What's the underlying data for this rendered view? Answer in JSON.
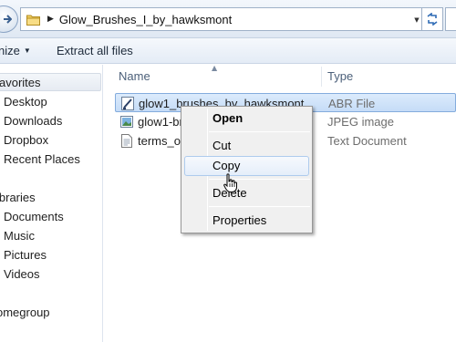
{
  "address_bar": {
    "path": "Glow_Brushes_I_by_hawksmont",
    "separator": "▶",
    "dropdown": "▼"
  },
  "toolbar": {
    "organize_label": "nize",
    "organize_arrow": "▼",
    "extract_label": "Extract all files"
  },
  "nav": {
    "favorites_label": "avorites",
    "favorites": [
      "Desktop",
      "Downloads",
      "Dropbox",
      "Recent Places"
    ],
    "libraries_label": "ibraries",
    "libraries": [
      "Documents",
      "Music",
      "Pictures",
      "Videos"
    ],
    "homegroup_label": "omegroup"
  },
  "file_list": {
    "columns": {
      "name": "Name",
      "type": "Type"
    },
    "sort_caret": "▲",
    "files": [
      {
        "name": "glow1_brushes_by_hawksmont",
        "type": "ABR File",
        "icon": "abr-file-icon",
        "selected": true
      },
      {
        "name": "glow1-br",
        "type": "JPEG image",
        "icon": "jpeg-image-icon",
        "selected": false
      },
      {
        "name": "terms_of_",
        "type": "Text Document",
        "icon": "text-document-icon",
        "selected": false
      }
    ]
  },
  "context_menu": {
    "open": "Open",
    "cut": "Cut",
    "copy": "Copy",
    "delete": "Delete",
    "properties": "Properties",
    "highlighted_item": "copy"
  },
  "colors": {
    "selection_fill": "#c5dcf7",
    "selection_border": "#84acdd",
    "menu_background": "#f0f0f0",
    "column_header_text": "#4c607a",
    "type_text": "#6d6d6d"
  }
}
